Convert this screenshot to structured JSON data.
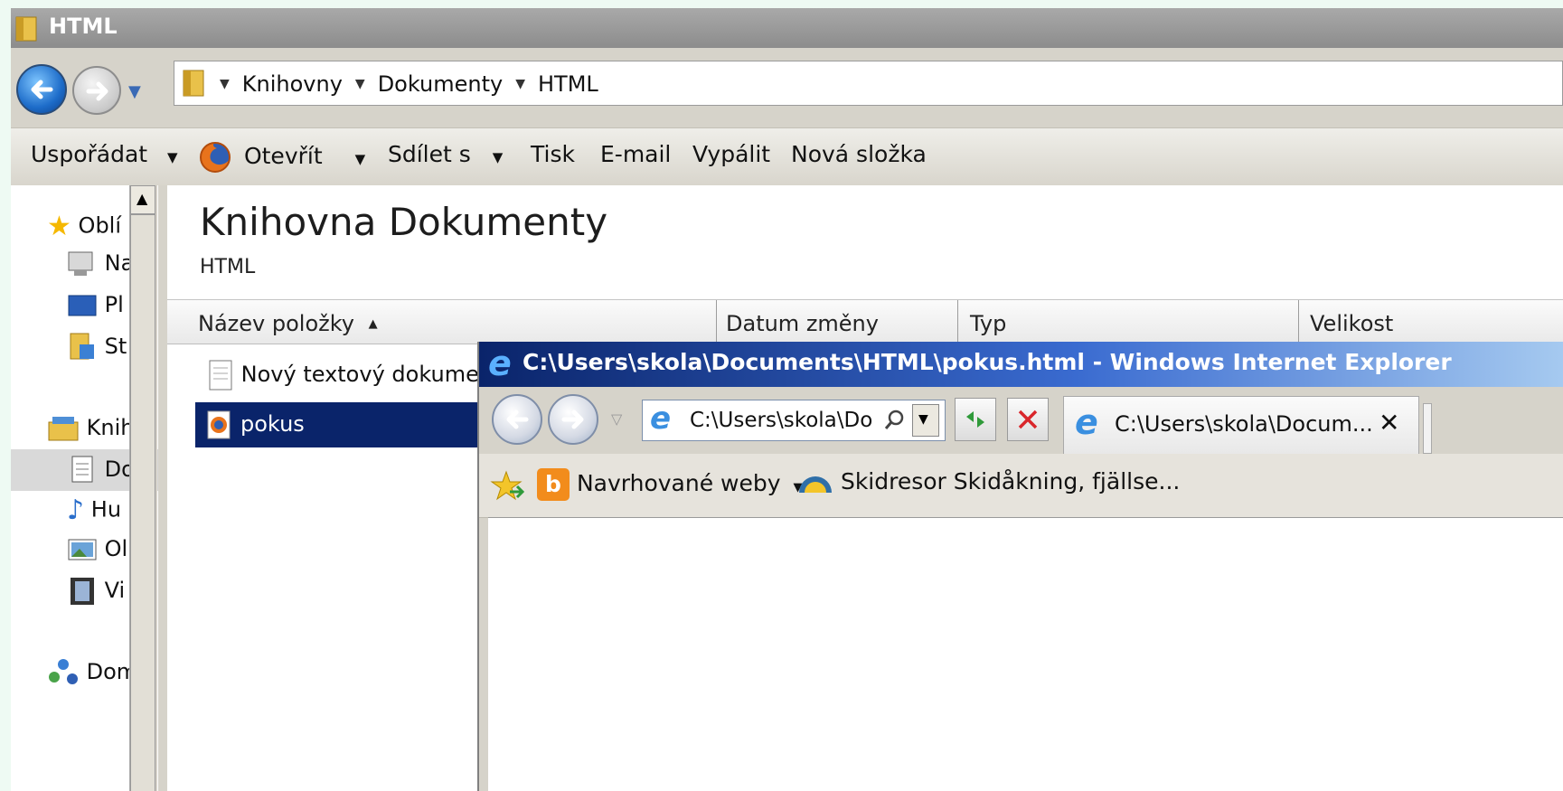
{
  "explorer": {
    "window_title": "HTML",
    "breadcrumb": [
      "Knihovny",
      "Dokumenty",
      "HTML"
    ],
    "toolbar": {
      "organize": "Uspořádat",
      "open": "Otevřít",
      "share": "Sdílet s",
      "print": "Tisk",
      "email": "E-mail",
      "burn": "Vypálit",
      "new_folder": "Nová složka"
    },
    "nav_items": [
      "Oblí",
      "Na",
      "Pl",
      "St",
      "Knih",
      "Do",
      "Hu",
      "Ol",
      "Vi",
      "Dom"
    ],
    "library": {
      "title": "Knihovna Dokumenty",
      "subtitle": "HTML"
    },
    "columns": [
      "Název položky",
      "Datum změny",
      "Typ",
      "Velikost"
    ],
    "files": [
      "Nový textový dokument",
      "pokus"
    ]
  },
  "ie": {
    "title": "C:\\Users\\skola\\Documents\\HTML\\pokus.html - Windows Internet Explorer",
    "address": "C:\\Users\\skola\\Do",
    "tab_label": "C:\\Users\\skola\\Docum...",
    "tab_close": "✕",
    "favorites": {
      "suggested": "Navrhované weby",
      "site": "Skidresor Skidåkning, fjällse..."
    }
  },
  "colors": {
    "selection": "#0a246a",
    "accent_blue": "#1d6cc9"
  },
  "icons": [
    "folder-icon",
    "firefox-icon",
    "star-icon",
    "ie-icon",
    "search-icon",
    "refresh-icon",
    "stop-icon",
    "bing-icon",
    "sky-icon"
  ]
}
